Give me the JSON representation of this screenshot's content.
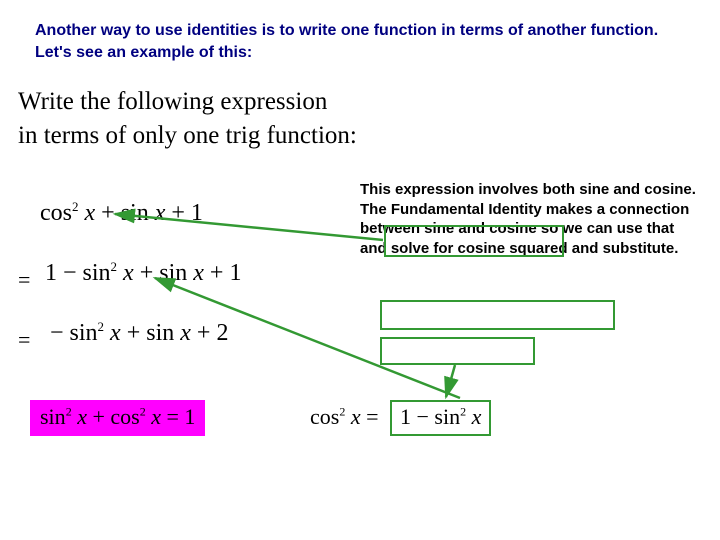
{
  "intro": "Another way to use identities is to write one function in terms of another function.  Let's see an example of this:",
  "prompt_line1": "Write the following expression",
  "prompt_line2": "in terms of only one trig function:",
  "exprs": {
    "e1_a": "cos",
    "e1_b": "x",
    "e1_c": " + sin ",
    "e1_d": "x",
    "e1_e": " + 1",
    "e2_a": "1 − sin",
    "e2_b": "x",
    "e2_c": " + sin ",
    "e2_d": "x",
    "e2_e": " + 1",
    "e3_a": "− sin",
    "e3_b": "x",
    "e3_c": " + sin ",
    "e3_d": "x",
    "e3_e": " + 2"
  },
  "identity": {
    "a": "sin",
    "b": "x",
    "c": " + cos",
    "d": "x",
    "eq": "  =  1"
  },
  "cos_solved": {
    "lhs_a": "cos",
    "lhs_b": "x",
    "eq": "  = ",
    "rhs_a": "1 − sin",
    "rhs_b": "x"
  },
  "explain": "This expression involves both sine and cosine.  The Fundamental Identity makes a connection between sine and cosine so we can use that and solve for cosine squared and substitute.",
  "sup2": "2",
  "equals": "="
}
